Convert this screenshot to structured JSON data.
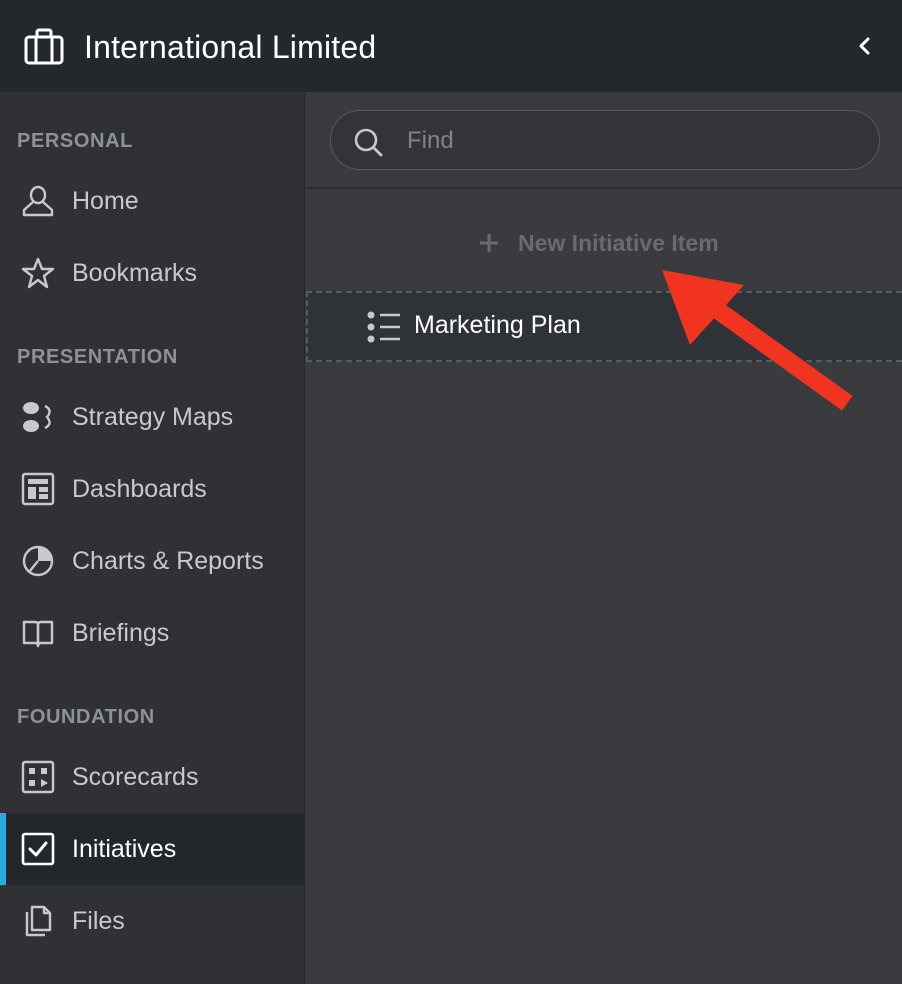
{
  "header": {
    "org_name": "International Limited",
    "org_icon": "briefcase-icon",
    "collapse_icon": "chevron-left-icon"
  },
  "sidebar": {
    "sections": [
      {
        "title": "PERSONAL",
        "items": [
          {
            "label": "Home",
            "icon": "person-icon"
          },
          {
            "label": "Bookmarks",
            "icon": "star-icon"
          }
        ]
      },
      {
        "title": "PRESENTATION",
        "items": [
          {
            "label": "Strategy Maps",
            "icon": "strategy-map-icon"
          },
          {
            "label": "Dashboards",
            "icon": "dashboard-icon"
          },
          {
            "label": "Charts & Reports",
            "icon": "pie-chart-icon"
          },
          {
            "label": "Briefings",
            "icon": "book-icon"
          }
        ]
      },
      {
        "title": "FOUNDATION",
        "items": [
          {
            "label": "Scorecards",
            "icon": "scorecard-icon"
          },
          {
            "label": "Initiatives",
            "icon": "checkbox-icon",
            "active": true
          },
          {
            "label": "Files",
            "icon": "files-icon"
          }
        ]
      }
    ],
    "active_color": "#2aa8e0"
  },
  "main": {
    "search": {
      "placeholder": "Find",
      "value": "",
      "icon": "search-icon"
    },
    "new_item": {
      "label": "New Initiative Item",
      "icon": "plus-icon"
    },
    "items": [
      {
        "label": "Marketing Plan",
        "icon": "list-icon"
      }
    ]
  },
  "annotation": {
    "type": "arrow",
    "color": "#f0341f"
  }
}
